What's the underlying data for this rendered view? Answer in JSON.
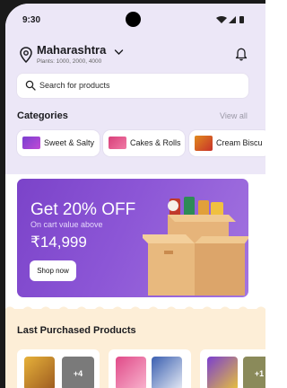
{
  "status_bar": {
    "time": "9:30"
  },
  "location": {
    "state": "Maharashtra",
    "plants": "Plants: 1000, 2000, 4000"
  },
  "search": {
    "placeholder": "Search for products"
  },
  "categories": {
    "title": "Categories",
    "view_all": "View all",
    "items": [
      {
        "label": "Sweet & Salty"
      },
      {
        "label": "Cakes & Rolls"
      },
      {
        "label": "Cream Biscu"
      }
    ]
  },
  "promo": {
    "headline": "Get 20% OFF",
    "subtext": "On cart value above",
    "amount": "₹14,999",
    "button": "Shop now"
  },
  "last_purchased": {
    "title": "Last Purchased Products",
    "cards": [
      {
        "more": "+4"
      },
      {
        "more": ""
      },
      {
        "more": "+1"
      }
    ]
  },
  "colors": {
    "header_bg": "#ece7f7",
    "promo_start": "#7b43c9",
    "promo_end": "#a374e0",
    "section_bg": "#fdeed7"
  }
}
